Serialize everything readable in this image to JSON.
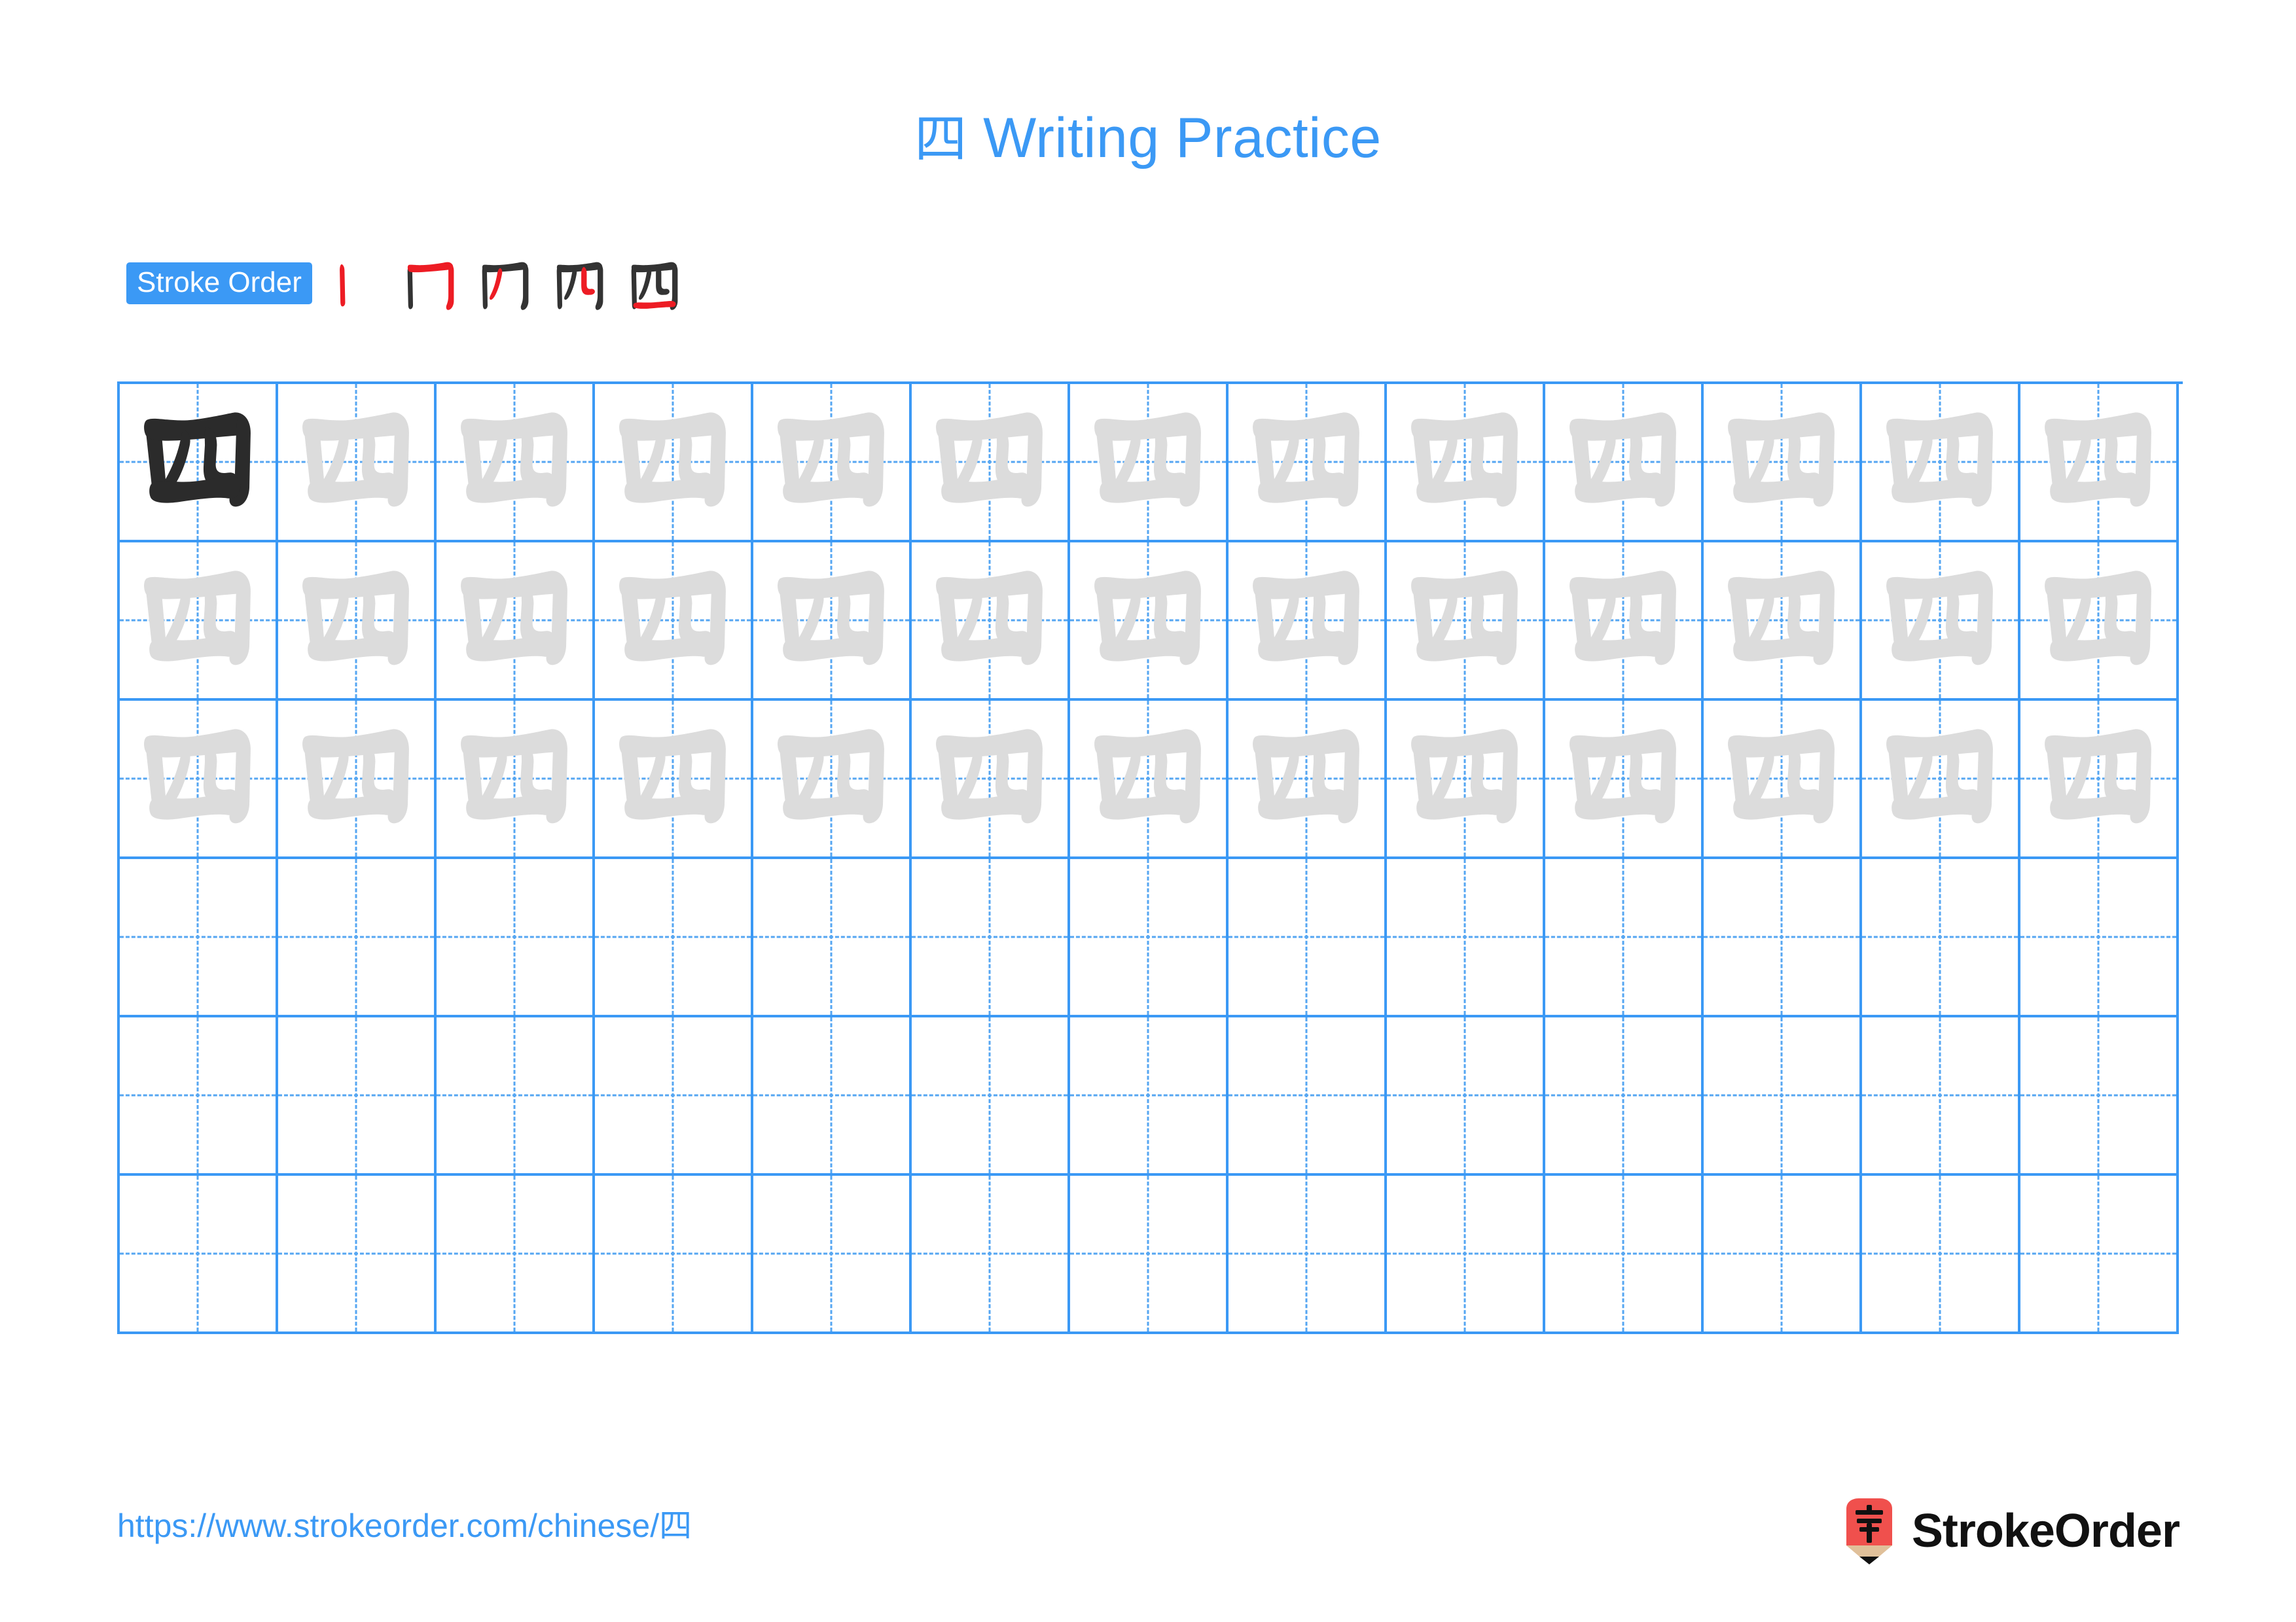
{
  "document": {
    "character": "四",
    "title_prefix": "四",
    "title_suffix": " Writing Practice",
    "title_full": "四 Writing Practice"
  },
  "colors": {
    "accent_blue": "#3B99F5",
    "grid_line": "#3B99F5",
    "grid_guide_dashed": "#55A6F2",
    "traced_character": "#DCDCDC",
    "solid_character": "#2B2B2B",
    "stroke_highlight_red": "#ED1C24",
    "stroke_inactive_dark": "#333333",
    "logo_red": "#F0504D",
    "logo_wood": "#E0C09A",
    "brand_text": "#111111"
  },
  "stroke_order": {
    "badge_label": "Stroke Order",
    "total_strokes": 5,
    "steps": [
      {
        "index": 1,
        "name": "stroke-step-1",
        "new_stroke": "竖 (vertical)"
      },
      {
        "index": 2,
        "name": "stroke-step-2",
        "new_stroke": "横折 (horizontal-turn)"
      },
      {
        "index": 3,
        "name": "stroke-step-3",
        "new_stroke": "撇 (inner left)"
      },
      {
        "index": 4,
        "name": "stroke-step-4",
        "new_stroke": "竖弯 (inner right)"
      },
      {
        "index": 5,
        "name": "stroke-step-5",
        "new_stroke": "横 (bottom seal)"
      }
    ]
  },
  "practice_grid": {
    "columns": 13,
    "rows": 6,
    "rows_data": [
      {
        "index": 1,
        "cells": [
          "solid",
          "traced",
          "traced",
          "traced",
          "traced",
          "traced",
          "traced",
          "traced",
          "traced",
          "traced",
          "traced",
          "traced",
          "traced"
        ]
      },
      {
        "index": 2,
        "cells": [
          "traced",
          "traced",
          "traced",
          "traced",
          "traced",
          "traced",
          "traced",
          "traced",
          "traced",
          "traced",
          "traced",
          "traced",
          "traced"
        ]
      },
      {
        "index": 3,
        "cells": [
          "traced",
          "traced",
          "traced",
          "traced",
          "traced",
          "traced",
          "traced",
          "traced",
          "traced",
          "traced",
          "traced",
          "traced",
          "traced"
        ]
      },
      {
        "index": 4,
        "cells": [
          "empty",
          "empty",
          "empty",
          "empty",
          "empty",
          "empty",
          "empty",
          "empty",
          "empty",
          "empty",
          "empty",
          "empty",
          "empty"
        ]
      },
      {
        "index": 5,
        "cells": [
          "empty",
          "empty",
          "empty",
          "empty",
          "empty",
          "empty",
          "empty",
          "empty",
          "empty",
          "empty",
          "empty",
          "empty",
          "empty"
        ]
      },
      {
        "index": 6,
        "cells": [
          "empty",
          "empty",
          "empty",
          "empty",
          "empty",
          "empty",
          "empty",
          "empty",
          "empty",
          "empty",
          "empty",
          "empty",
          "empty"
        ]
      }
    ]
  },
  "footer": {
    "url": "https://www.strokeorder.com/chinese/四",
    "brand_name": "StrokeOrder",
    "logo_character": "字"
  }
}
